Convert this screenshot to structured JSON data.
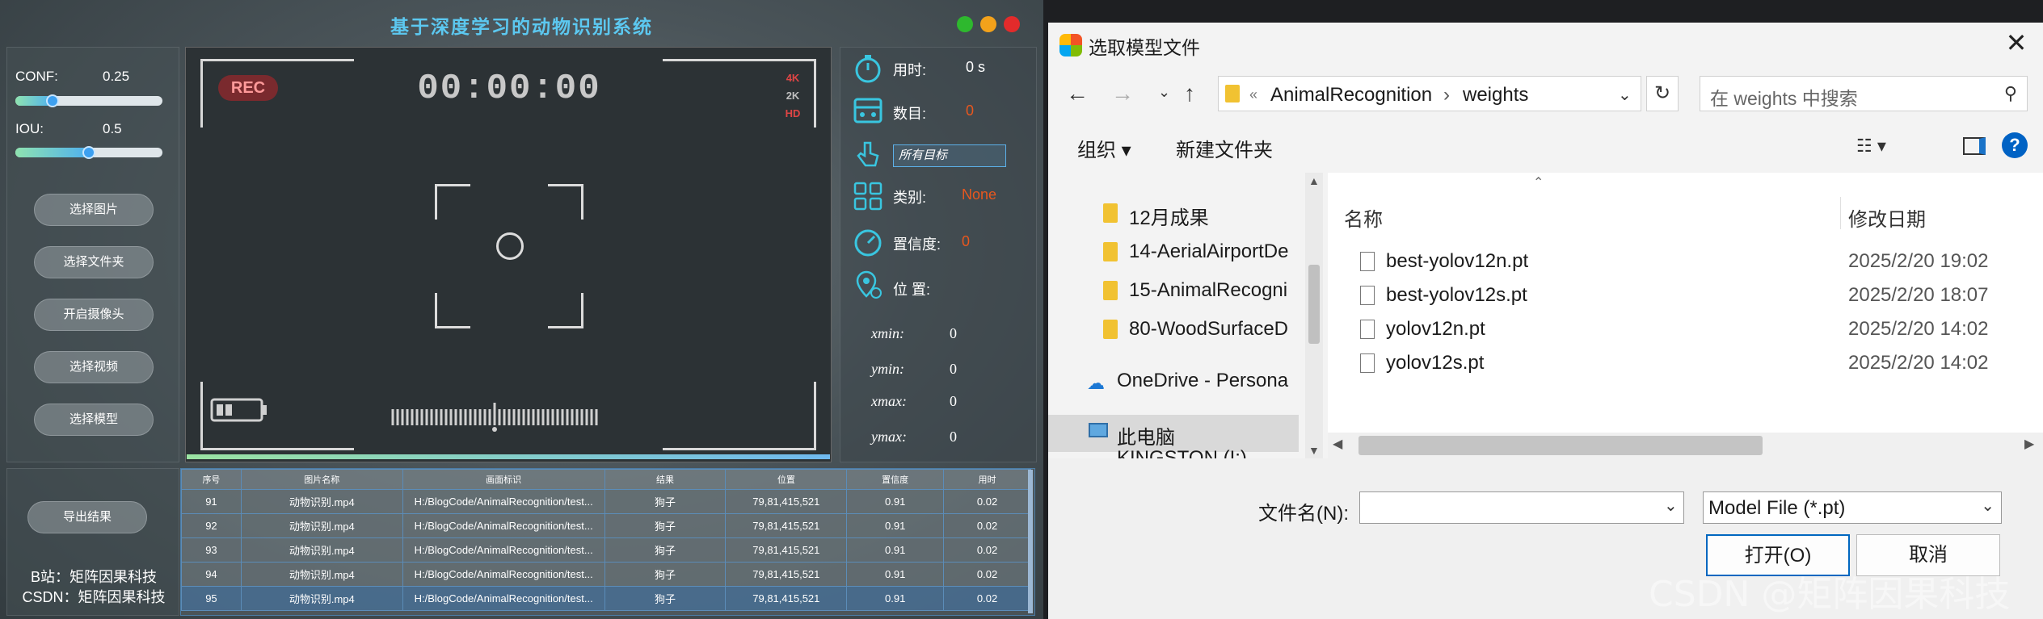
{
  "app": {
    "title": "基于深度学习的动物识别系统",
    "conf_label": "CONF:",
    "conf_value": "0.25",
    "conf_fraction": 0.25,
    "iou_label": "IOU:",
    "iou_value": "0.5",
    "iou_fraction": 0.5,
    "buttons": [
      "选择图片",
      "选择文件夹",
      "开启摄像头",
      "选择视频",
      "选择模型"
    ],
    "export_button": "导出结果",
    "credit_bilibili": "B站：矩阵因果科技",
    "credit_csdn": "CSDN：矩阵因果科技",
    "camera": {
      "rec": "REC",
      "timer": "00:00:00",
      "res_4k": "4K",
      "res_2k": "2K",
      "res_hd": "HD"
    },
    "info": {
      "time_label": "用时:",
      "time_value": "0 s",
      "count_label": "数目:",
      "count_value": "0",
      "target_select": "所有目标",
      "class_label": "类别:",
      "class_value": "None",
      "conf_label": "置信度:",
      "conf_value": "0",
      "pos_label": "位 置:",
      "xmin_label": "xmin:",
      "xmin": "0",
      "ymin_label": "ymin:",
      "ymin": "0",
      "xmax_label": "xmax:",
      "xmax": "0",
      "ymax_label": "ymax:",
      "ymax": "0"
    },
    "table": {
      "headers": [
        "序号",
        "图片名称",
        "画面标识",
        "结果",
        "位置",
        "置信度",
        "用时"
      ],
      "rows": [
        [
          "91",
          "动物识别.mp4",
          "H:/BlogCode/AnimalRecognition/test...",
          "狗子",
          "79,81,415,521",
          "0.91",
          "0.02"
        ],
        [
          "92",
          "动物识别.mp4",
          "H:/BlogCode/AnimalRecognition/test...",
          "狗子",
          "79,81,415,521",
          "0.91",
          "0.02"
        ],
        [
          "93",
          "动物识别.mp4",
          "H:/BlogCode/AnimalRecognition/test...",
          "狗子",
          "79,81,415,521",
          "0.91",
          "0.02"
        ],
        [
          "94",
          "动物识别.mp4",
          "H:/BlogCode/AnimalRecognition/test...",
          "狗子",
          "79,81,415,521",
          "0.91",
          "0.02"
        ],
        [
          "95",
          "动物识别.mp4",
          "H:/BlogCode/AnimalRecognition/test...",
          "狗子",
          "79,81,415,521",
          "0.91",
          "0.02"
        ]
      ]
    },
    "colors": {
      "title": "#5cc8f0",
      "accent_value": "#e8571e"
    }
  },
  "dialog": {
    "title": "选取模型文件",
    "breadcrumb_chevron": "«",
    "crumb_1": "AnimalRecognition",
    "crumb_sep": "›",
    "crumb_2": "weights",
    "search_placeholder": "在 weights 中搜索",
    "organize": "组织 ▾",
    "new_folder": "新建文件夹",
    "help": "?",
    "nav_items": [
      "12月成果",
      "14-AerialAirportDe",
      "15-AnimalRecogni",
      "80-WoodSurfaceD",
      "OneDrive - Persona",
      "此电脑",
      "KINGSTON (I:)"
    ],
    "col_name": "名称",
    "col_date": "修改日期",
    "files": [
      {
        "name": "best-yolov12n.pt",
        "date": "2025/2/20 19:02"
      },
      {
        "name": "best-yolov12s.pt",
        "date": "2025/2/20 18:07"
      },
      {
        "name": "yolov12n.pt",
        "date": "2025/2/20 14:02"
      },
      {
        "name": "yolov12s.pt",
        "date": "2025/2/20 14:02"
      }
    ],
    "filename_label": "文件名(N):",
    "filename_value": "",
    "filetype": "Model File (*.pt)",
    "open_button": "打开(O)",
    "cancel_button": "取消"
  },
  "watermark": "CSDN @矩阵因果科技"
}
